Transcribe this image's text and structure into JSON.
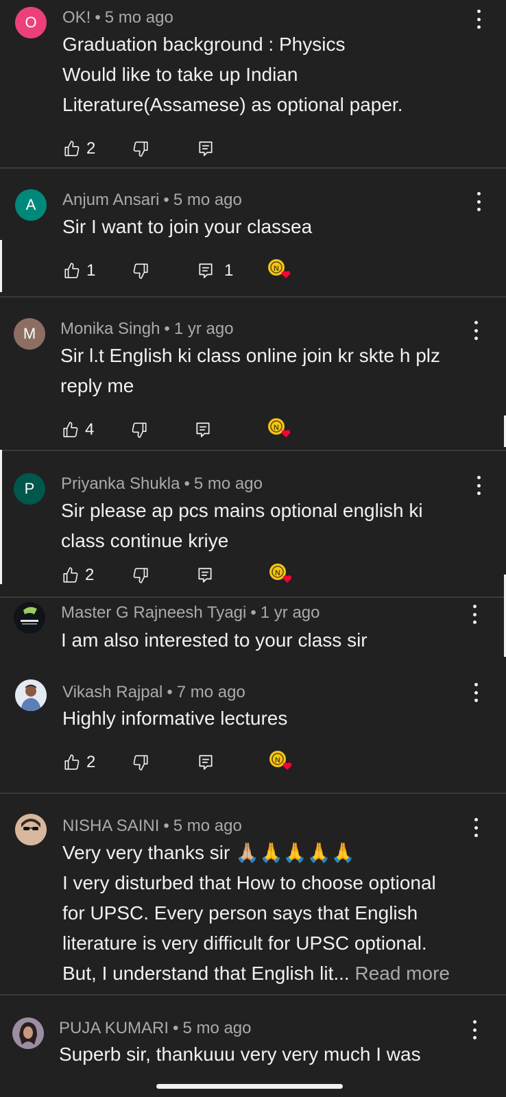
{
  "comments": [
    {
      "author": "OK!",
      "time": "5 mo ago",
      "avatar_letter": "O",
      "avatar_color": "#ec407a",
      "lines": [
        "Graduation background : Physics",
        "Would like to take up Indian",
        "Literature(Assamese) as optional paper."
      ],
      "likes": "2",
      "replies": ""
    },
    {
      "author": "Anjum Ansari",
      "time": "5 mo ago",
      "avatar_letter": "A",
      "avatar_color": "#00897b",
      "lines": [
        "Sir I want to join your classea"
      ],
      "likes": "1",
      "replies": "1",
      "hearted": true
    },
    {
      "author": "Monika Singh",
      "time": "1 yr ago",
      "avatar_letter": "M",
      "avatar_color": "#8d6e63",
      "lines": [
        "Sir l.t English ki class online join kr skte h plz",
        "reply me"
      ],
      "likes": "4",
      "replies": "",
      "hearted": true
    },
    {
      "author": "Priyanka Shukla",
      "time": "5 mo ago",
      "avatar_letter": "P",
      "avatar_color": "#00574b",
      "lines": [
        "Sir please ap pcs mains optional english ki",
        "class continue kriye"
      ],
      "likes": "2",
      "replies": "",
      "hearted": true
    },
    {
      "author": "Master G Rajneesh Tyagi",
      "time": "1 yr ago",
      "lines": [
        "I am also interested to your class sir"
      ]
    },
    {
      "author": "Vikash Rajpal",
      "time": "7 mo ago",
      "lines": [
        "Highly informative lectures"
      ],
      "likes": "2",
      "replies": "",
      "hearted": true
    },
    {
      "author": "NISHA SAINI",
      "time": "5 mo ago",
      "lines": [
        "Very very thanks sir 🙏🏼🙏🙏🙏🙏",
        "I very disturbed that How to choose optional",
        "for UPSC. Every person says that English",
        "literature is very difficult for UPSC optional.",
        "But, I understand that English lit..."
      ],
      "read_more": "Read more"
    },
    {
      "author": "PUJA KUMARI",
      "time": "5 mo ago",
      "lines": [
        "Superb sir, thankuuu very very much I was"
      ]
    }
  ],
  "colors": {
    "background": "#212121",
    "text": "#f1f1f1",
    "secondary": "#aaaaaa",
    "heart": "#ff0033",
    "badge": "#f5c518"
  }
}
